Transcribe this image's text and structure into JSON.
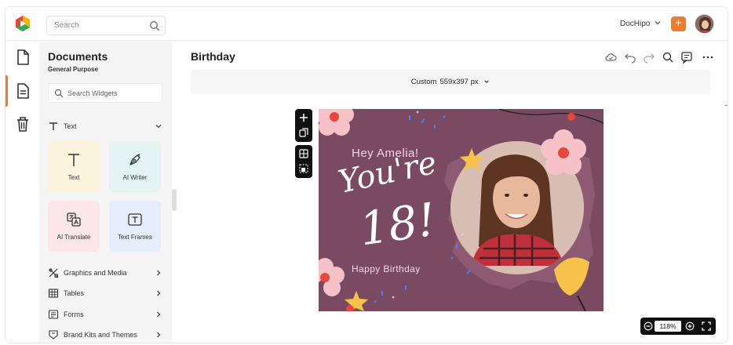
{
  "header": {
    "search_placeholder": "Search",
    "workspace": "DocHipo"
  },
  "sidebar": {
    "title": "Documents",
    "subtitle": "General Purpose",
    "widget_search_placeholder": "Search Widgets",
    "text_section": "Text",
    "tiles": [
      {
        "label": "Text",
        "bg": "#fdf4de"
      },
      {
        "label": "AI Writer",
        "bg": "#e3f4f3"
      },
      {
        "label": "AI Translate",
        "bg": "#fbe7e7"
      },
      {
        "label": "Text Frames",
        "bg": "#e5eefa"
      }
    ],
    "sections": [
      {
        "label": "Graphics and Media"
      },
      {
        "label": "Tables"
      },
      {
        "label": "Forms"
      },
      {
        "label": "Brand Kits and Themes"
      }
    ]
  },
  "main": {
    "doc_title": "Birthday",
    "size_label": "Custom",
    "size_value": "559x397 px",
    "zoom": "118%"
  },
  "design": {
    "greeting": "Hey Amelia!",
    "line1": "You're",
    "line2": "18!",
    "footer": "Happy Birthday"
  },
  "colors": {
    "accent": "#f07c2a",
    "card_bg": "#7a4a63"
  }
}
